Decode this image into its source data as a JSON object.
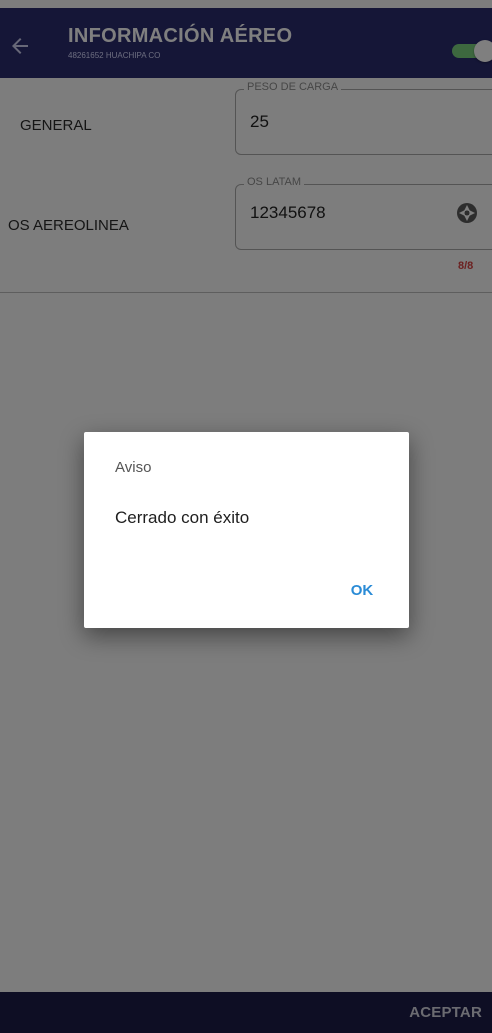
{
  "header": {
    "title": "INFORMACIÓN AÉREO",
    "subtitle": "48261652 HUACHIPA CO",
    "toggle_on": true
  },
  "form": {
    "row1": {
      "label": "GENERAL",
      "field_label": "PESO DE CARGA",
      "field_value": "25"
    },
    "row2": {
      "label": "OS AEREOLINEA",
      "field_label": "OS LATAM",
      "field_value": "12345678",
      "counter": "8/8"
    }
  },
  "dialog": {
    "title": "Aviso",
    "message": "Cerrado con éxito",
    "ok_label": "OK"
  },
  "footer": {
    "accept_label": "ACEPTAR"
  },
  "colors": {
    "appbar": "#2a2c6f",
    "toggle": "#7bd17f",
    "ok": "#2a8bd6",
    "counter": "#d84343",
    "bottombar": "#1c1d48"
  }
}
